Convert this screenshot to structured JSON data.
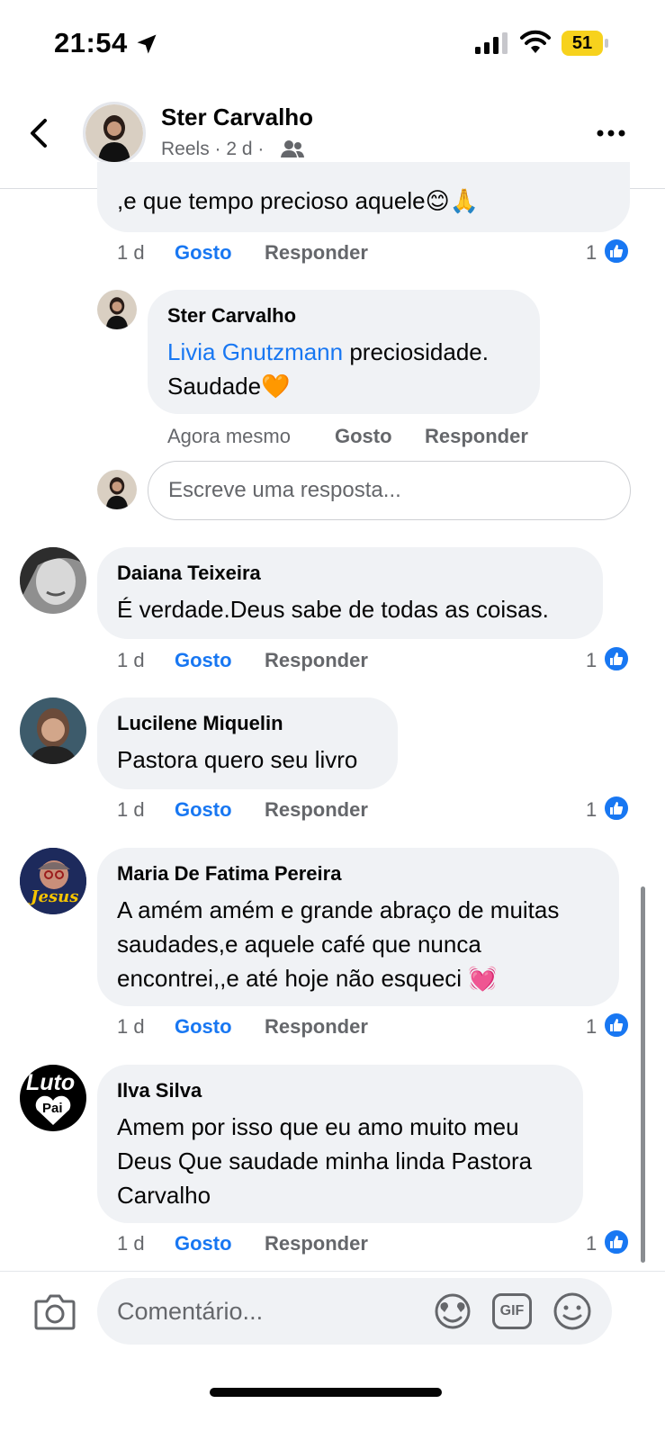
{
  "status": {
    "time": "21:54",
    "battery": "51"
  },
  "header": {
    "name": "Ster Carvalho",
    "meta": "Reels · 2 d ·"
  },
  "top_comment": {
    "text": ",e que tempo precioso aquele😊🙏",
    "time": "1 d",
    "like": "Gosto",
    "reply": "Responder",
    "count": "1"
  },
  "reply": {
    "author": "Ster Carvalho",
    "mention": "Livia Gnutzmann",
    "text_line1": " preciosidade.",
    "text_line2": "Saudade🧡",
    "time": "Agora mesmo",
    "like": "Gosto",
    "reply": "Responder"
  },
  "reply_input": {
    "placeholder": "Escreve uma resposta..."
  },
  "comments": [
    {
      "author": "Daiana Teixeira",
      "lines": [
        "É verdade.Deus sabe de todas as coisas."
      ],
      "time": "1 d",
      "like": "Gosto",
      "reply": "Responder",
      "count": "1"
    },
    {
      "author": "Lucilene Miquelin",
      "lines": [
        "Pastora quero seu livro"
      ],
      "time": "1 d",
      "like": "Gosto",
      "reply": "Responder",
      "count": "1"
    },
    {
      "author": "Maria De Fatima Pereira",
      "lines": [
        "A amém amém e grande abraço de muitas",
        "saudades,e aquele café que nunca",
        "encontrei,,e até hoje não esqueci 💓"
      ],
      "time": "1 d",
      "like": "Gosto",
      "reply": "Responder",
      "count": "1",
      "avatar_text": "Jesus"
    },
    {
      "author": "Ilva Silva",
      "lines": [
        "Amem por isso que eu amo muito meu",
        "Deus Que saudade minha linda Pastora",
        "Carvalho"
      ],
      "time": "1 d",
      "like": "Gosto",
      "reply": "Responder",
      "count": "1",
      "avatar_text_1": "Luto",
      "avatar_text_2": "Pai"
    }
  ],
  "composer": {
    "placeholder": "Comentário...",
    "gif_label": "GIF"
  },
  "icons": {
    "back": "chevron-left-icon",
    "more": "more-dots-icon",
    "camera": "camera-icon",
    "sticker": "sticker-icon",
    "gif": "gif-icon",
    "emoji": "emoji-icon",
    "friends": "friends-icon",
    "like": "thumbs-up-icon"
  },
  "colors": {
    "accent": "#1877f2",
    "bubble": "#f0f2f5",
    "battery": "#f7d21d"
  }
}
